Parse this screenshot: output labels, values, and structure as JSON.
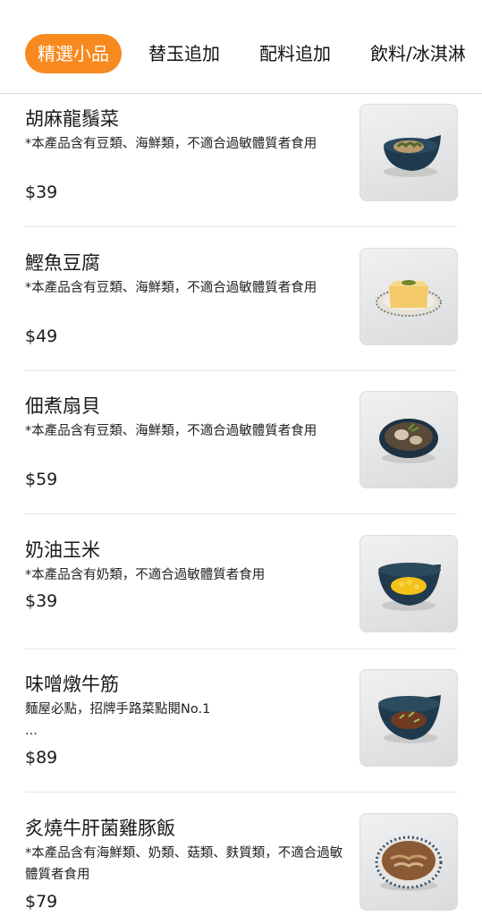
{
  "tabs": [
    {
      "label": "精選小品",
      "active": true
    },
    {
      "label": "替玉追加",
      "active": false
    },
    {
      "label": "配料追加",
      "active": false
    },
    {
      "label": "飲料/冰淇淋",
      "active": false
    }
  ],
  "colors": {
    "accent": "#f7891f",
    "divider": "#e6e6e6"
  },
  "menu": {
    "items": [
      {
        "name": "胡麻龍鬚菜",
        "desc": "*本產品含有豆類、海鮮類，不適合過敏體質者食用",
        "price": "$39",
        "image_icon": "bowl-greens-icon"
      },
      {
        "name": "鰹魚豆腐",
        "desc": "*本產品含有豆類、海鮮類，不適合過敏體質者食用",
        "price": "$49",
        "image_icon": "tofu-plate-icon"
      },
      {
        "name": "佃煮扇貝",
        "desc": "*本產品含有豆類、海鮮類，不適合過敏體質者食用",
        "price": "$59",
        "image_icon": "scallop-bowl-icon"
      },
      {
        "name": "奶油玉米",
        "desc": "*本產品含有奶類，不適合過敏體質者食用",
        "price": "$39",
        "image_icon": "corn-bowl-icon"
      },
      {
        "name": "味噌燉牛筋",
        "desc": "麵屋必點，招牌手路菜點閱No.1\n...",
        "price": "$89",
        "image_icon": "beef-tendon-bowl-icon"
      },
      {
        "name": "炙燒牛肝菌雞豚飯",
        "desc": "*本產品含有海鮮類、奶類、菇類、麩質類，不適合過敏體質者食用",
        "price": "$79",
        "image_icon": "rice-bowl-icon"
      }
    ]
  }
}
